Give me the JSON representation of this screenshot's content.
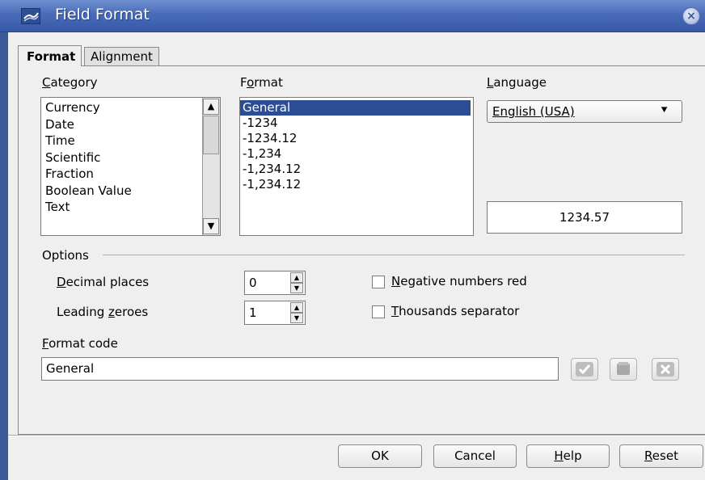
{
  "window": {
    "title": "Field Format",
    "app_icon": "writer-icon",
    "close_icon": "close-icon"
  },
  "tabs": [
    {
      "label": "Format",
      "active": true
    },
    {
      "label": "Alignment",
      "active": false
    }
  ],
  "category": {
    "label_u": "C",
    "label_rest": "ategory",
    "items": [
      "Currency",
      "Date",
      "Time",
      "Scientific",
      "Fraction",
      "Boolean Value",
      "Text"
    ]
  },
  "format": {
    "label_pre": "F",
    "label_u": "o",
    "label_rest": "rmat",
    "items": [
      "General",
      "-1234",
      "-1234.12",
      "-1,234",
      "-1,234.12",
      "-1,234.12"
    ],
    "selected_index": 0
  },
  "language": {
    "label_u": "L",
    "label_rest": "anguage",
    "selected": "English (USA)"
  },
  "preview": {
    "value": "1234.57"
  },
  "options": {
    "heading": "Options",
    "decimal_places": {
      "label_u": "D",
      "label_rest": "ecimal places",
      "value": "0"
    },
    "leading_zeroes": {
      "label_pre": "Leading ",
      "label_u": "z",
      "label_rest": "eroes",
      "value": "1"
    },
    "negative_red": {
      "label_u": "N",
      "label_rest": "egative numbers red",
      "checked": false
    },
    "thousands_sep": {
      "label_u": "T",
      "label_rest": "housands separator",
      "checked": false
    }
  },
  "format_code": {
    "label_u": "F",
    "label_rest": "ormat code",
    "value": "General"
  },
  "buttons": {
    "ok": "OK",
    "cancel": "Cancel",
    "help_u": "H",
    "help_rest": "elp",
    "reset_u": "R",
    "reset_rest": "eset"
  },
  "colors": {
    "title_bar": "#4a6cb8",
    "selection": "#2c4c93",
    "dialog_bg": "#efefef"
  }
}
